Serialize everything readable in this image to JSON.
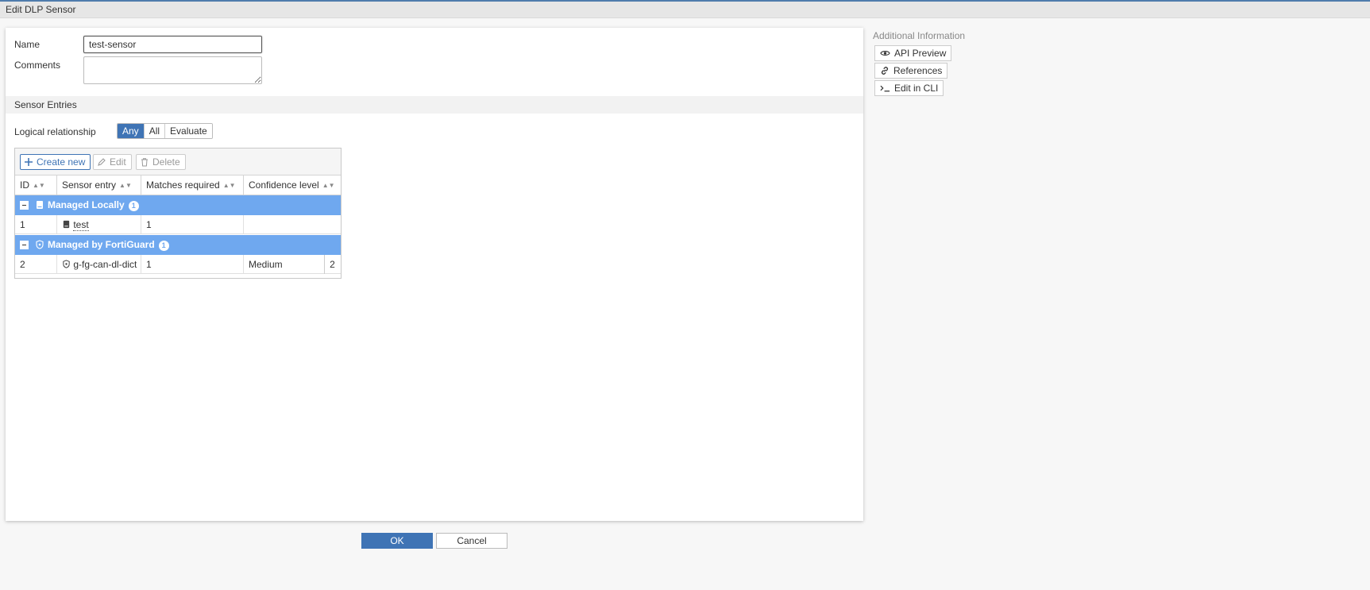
{
  "window": {
    "title": "Edit DLP Sensor"
  },
  "form": {
    "name_label": "Name",
    "name_value": "test-sensor",
    "comments_label": "Comments",
    "comments_value": ""
  },
  "sensor_entries": {
    "section_title": "Sensor Entries",
    "logical_label": "Logical relationship",
    "logical_options": [
      "Any",
      "All",
      "Evaluate"
    ],
    "logical_selected": "Any",
    "toolbar": {
      "create": "Create new",
      "edit": "Edit",
      "delete": "Delete"
    },
    "columns": [
      "ID",
      "Sensor entry",
      "Matches required",
      "Confidence level"
    ],
    "groups": [
      {
        "label": "Managed Locally",
        "count": "1",
        "icon": "dictionary-icon",
        "rows": [
          {
            "id": "1",
            "entry": "test",
            "matches": "1",
            "confidence": "",
            "icon": "dictionary-icon"
          }
        ]
      },
      {
        "label": "Managed by FortiGuard",
        "count": "1",
        "icon": "shield-icon",
        "rows": [
          {
            "id": "2",
            "entry": "g-fg-can-dl-dict",
            "matches": "1",
            "confidence": "Medium",
            "tail": "2",
            "icon": "shield-icon"
          }
        ]
      }
    ]
  },
  "sidebar": {
    "title": "Additional Information",
    "buttons": [
      {
        "label": "API Preview",
        "icon": "eye-icon"
      },
      {
        "label": "References",
        "icon": "link-icon"
      },
      {
        "label": "Edit in CLI",
        "icon": "terminal-icon"
      }
    ]
  },
  "footer": {
    "ok": "OK",
    "cancel": "Cancel"
  },
  "colors": {
    "primary": "#3f74b5",
    "group_row": "#6fa8ef"
  }
}
